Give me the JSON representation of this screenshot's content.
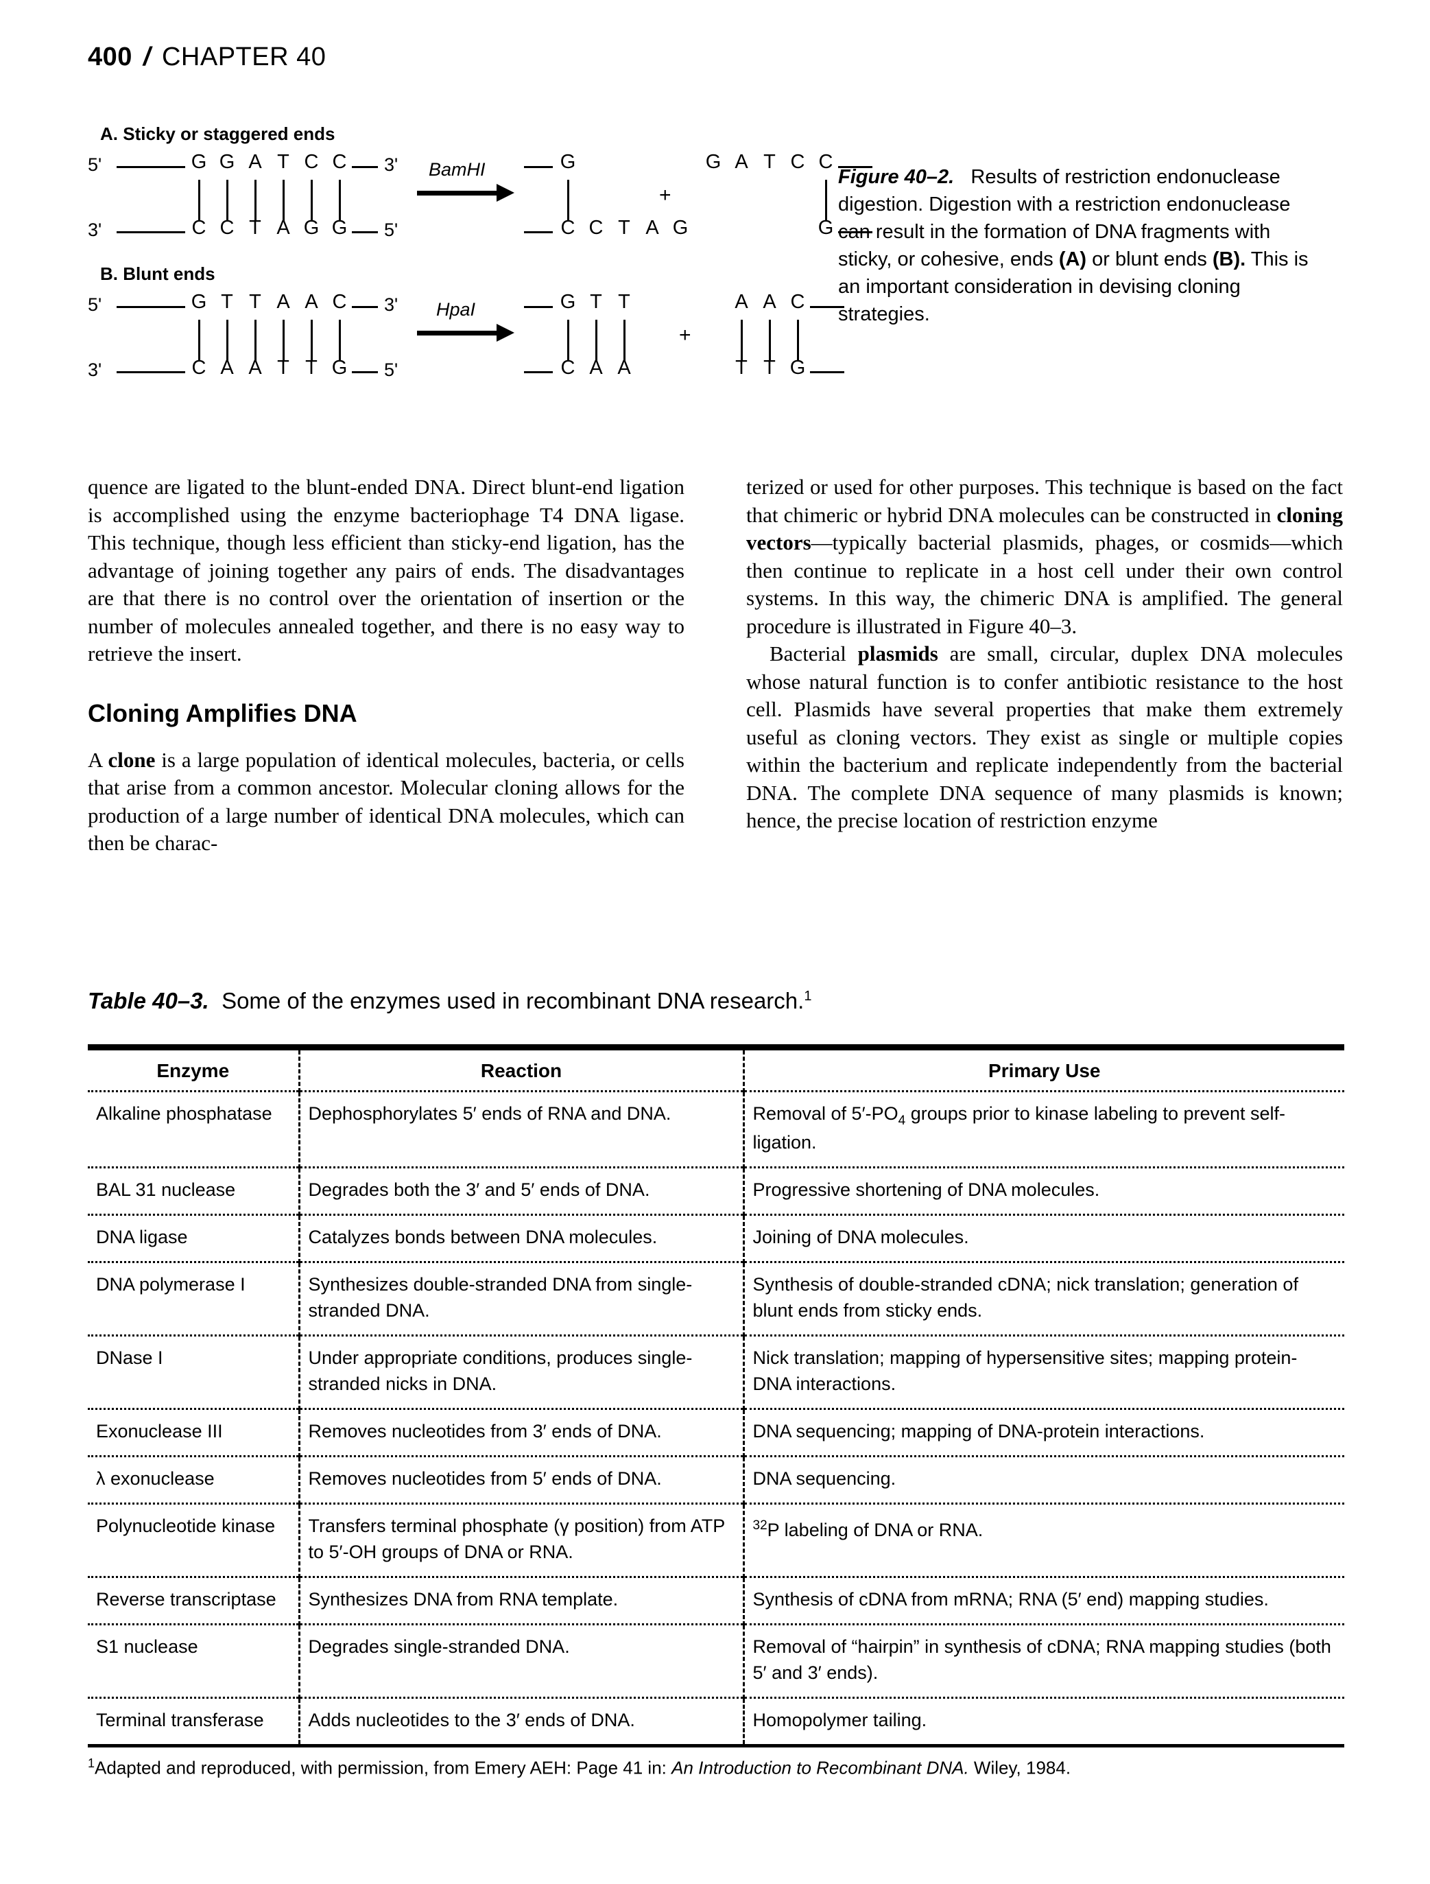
{
  "running_head": {
    "page_number": "400",
    "separator": "/",
    "chapter": "CHAPTER 40"
  },
  "figure": {
    "panel_a_label": "A. Sticky or staggered ends",
    "panel_b_label": "B. Blunt ends",
    "enzyme_a": "BamHI",
    "enzyme_b": "HpaI",
    "plus_sign": "+",
    "panel_a": {
      "left_top_prime": "5'",
      "left_bottom_prime": "3'",
      "right_top_prime": "3'",
      "right_bottom_prime": "5'",
      "top_strand": [
        "G",
        "G",
        "A",
        "T",
        "C",
        "C"
      ],
      "bottom_strand": [
        "C",
        "C",
        "T",
        "A",
        "G",
        "G"
      ],
      "product1_top": [
        "G"
      ],
      "product1_bottom": [
        "C",
        "C",
        "T",
        "A",
        "G"
      ],
      "product2_top": [
        "G",
        "A",
        "T",
        "C",
        "C"
      ],
      "product2_bottom": [
        "G"
      ]
    },
    "panel_b": {
      "left_top_prime": "5'",
      "left_bottom_prime": "3'",
      "right_top_prime": "3'",
      "right_bottom_prime": "5'",
      "top_strand": [
        "G",
        "T",
        "T",
        "A",
        "A",
        "C"
      ],
      "bottom_strand": [
        "C",
        "A",
        "A",
        "T",
        "T",
        "G"
      ],
      "product1_top": [
        "G",
        "T",
        "T"
      ],
      "product1_bottom": [
        "C",
        "A",
        "A"
      ],
      "product2_top": [
        "A",
        "A",
        "C"
      ],
      "product2_bottom": [
        "T",
        "T",
        "G"
      ]
    },
    "caption_label": "Figure 40–2.",
    "caption_text_1": "Results of restriction endonuclease digestion. Digestion with a restriction endonuclease can result in the formation of DNA fragments with sticky, or cohesive, ends ",
    "caption_bold_a": "(A)",
    "caption_text_2": " or blunt ends ",
    "caption_bold_b": "(B).",
    "caption_text_3": " This is an important consideration in devising cloning strategies."
  },
  "body": {
    "left_para_1": "quence are ligated to the blunt-ended DNA. Direct blunt-end ligation is accomplished using the enzyme bacteriophage T4 DNA ligase. This technique, though less efficient than sticky-end ligation, has the advantage of joining together any pairs of ends. The disadvantages are that there is no control over the orientation of insertion or the number of molecules annealed together, and there is no easy way to retrieve the insert.",
    "section_heading": "Cloning Amplifies DNA",
    "left_para_2_pre": "A ",
    "left_para_2_bold": "clone",
    "left_para_2_post": " is a large population of identical molecules, bacteria, or cells that arise from a common ancestor. Molecular cloning allows for the production of a large number of identical DNA molecules, which can then be charac-",
    "right_para_1_pre": "terized or used for other purposes. This technique is based on the fact that chimeric or hybrid DNA molecules can be constructed in ",
    "right_para_1_bold": "cloning vectors",
    "right_para_1_post": "—typically bacterial plasmids, phages, or cosmids—which then continue to replicate in a host cell under their own control systems. In this way, the chimeric DNA is amplified. The general procedure is illustrated in Figure 40–3.",
    "right_para_2_pre": "Bacterial ",
    "right_para_2_bold": "plasmids",
    "right_para_2_post": " are small, circular, duplex DNA molecules whose natural function is to confer antibiotic resistance to the host cell. Plasmids have several properties that make them extremely useful as cloning vectors. They exist as single or multiple copies within the bacterium and replicate independently from the bacterial DNA. The complete DNA sequence of many plasmids is known; hence, the precise location of restriction enzyme"
  },
  "table": {
    "label": "Table 40–3.",
    "caption": "Some of the enzymes used in recombinant DNA research.",
    "caption_superscript": "1",
    "columns": [
      "Enzyme",
      "Reaction",
      "Primary Use"
    ],
    "rows": [
      {
        "enzyme": "Alkaline phosphatase",
        "reaction": "Dephosphorylates 5′ ends of RNA and DNA.",
        "use_pre": "Removal of 5′-PO",
        "use_sub": "4",
        "use_post": " groups prior to kinase labeling to prevent self-ligation."
      },
      {
        "enzyme": "BAL 31 nuclease",
        "reaction": "Degrades both the 3′ and 5′ ends of DNA.",
        "use": "Progressive shortening of DNA molecules."
      },
      {
        "enzyme": "DNA ligase",
        "reaction": "Catalyzes bonds between DNA molecules.",
        "use": "Joining of DNA molecules."
      },
      {
        "enzyme": "DNA polymerase I",
        "reaction": "Synthesizes double-stranded DNA from single-stranded DNA.",
        "use": "Synthesis of double-stranded cDNA; nick translation; generation of blunt ends from sticky ends."
      },
      {
        "enzyme": "DNase I",
        "reaction": "Under appropriate conditions, produces single-stranded nicks in DNA.",
        "use": "Nick translation; mapping of hypersensitive sites; mapping protein-DNA interactions."
      },
      {
        "enzyme": "Exonuclease III",
        "reaction": "Removes nucleotides from 3′ ends of DNA.",
        "use": "DNA sequencing; mapping of DNA-protein interactions."
      },
      {
        "enzyme": "λ exonuclease",
        "reaction": "Removes nucleotides from 5′ ends of DNA.",
        "use": "DNA sequencing."
      },
      {
        "enzyme": "Polynucleotide kinase",
        "reaction": "Transfers terminal phosphate (γ position) from ATP to 5′-OH groups of DNA or RNA.",
        "use_sup": "32",
        "use_post": "P labeling of DNA or RNA."
      },
      {
        "enzyme": "Reverse transcriptase",
        "reaction": "Synthesizes DNA from RNA template.",
        "use": "Synthesis of cDNA from mRNA; RNA (5′ end) mapping studies."
      },
      {
        "enzyme": "S1 nuclease",
        "reaction": "Degrades single-stranded DNA.",
        "use": "Removal of “hairpin” in synthesis of cDNA; RNA mapping studies (both 5′ and 3′ ends)."
      },
      {
        "enzyme": "Terminal transferase",
        "reaction": "Adds nucleotides to the 3′ ends of DNA.",
        "use": "Homopolymer tailing."
      }
    ],
    "footnote_marker": "1",
    "footnote_pre": "Adapted and reproduced, with permission, from Emery AEH: Page 41 in: ",
    "footnote_italic": "An Introduction to Recombinant DNA.",
    "footnote_post": " Wiley, 1984."
  }
}
